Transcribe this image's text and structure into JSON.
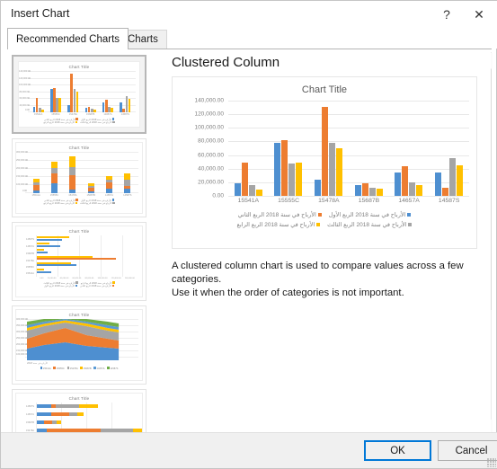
{
  "window": {
    "title": "Insert Chart",
    "help_icon": "question-mark-icon",
    "close_icon": "close-icon",
    "help_label": "?",
    "close_label": "✕"
  },
  "tabs": [
    {
      "label": "Recommended Charts",
      "active": true
    },
    {
      "label": "All Charts",
      "active": false
    }
  ],
  "scrollbar": {
    "up_arrow": "˄",
    "down_arrow": "˅"
  },
  "preview": {
    "heading": "Clustered Column",
    "description_line1": "A clustered column chart is used to compare values across a few categories.",
    "description_line2": "Use it when the order of categories is not important."
  },
  "footer": {
    "ok_label": "OK",
    "cancel_label": "Cancel"
  },
  "colors": {
    "series1": "#4e8fd0",
    "series2": "#ed7d31",
    "series3": "#a5a5a5",
    "series4": "#ffc000",
    "series5": "#5b9bd5",
    "series6": "#70ad47",
    "accent": "#0078d7",
    "gridline": "#e8e8e8",
    "axis_text": "#7f7f7f"
  },
  "chart_data": {
    "type": "bar",
    "title": "Chart Title",
    "xlabel": "",
    "ylabel": "",
    "ylim": [
      0,
      140000
    ],
    "ytick_labels": [
      "140,000.00",
      "120,000.00",
      "100,000.00",
      "80,000.00",
      "60,000.00",
      "40,000.00",
      "20,000.00",
      "0.00"
    ],
    "yticks": [
      140000,
      120000,
      100000,
      80000,
      60000,
      40000,
      20000,
      0
    ],
    "grid": true,
    "legend_position": "bottom",
    "categories": [
      "15541A",
      "15555C",
      "15478A",
      "15687B",
      "14657A",
      "14587S"
    ],
    "series": [
      {
        "name": "الأرباح في سنة 2018 الربع الأول",
        "color": "#4e8fd0",
        "values": [
          18000,
          78500,
          24000,
          16500,
          35000,
          35000
        ]
      },
      {
        "name": "الأرباح في سنة 2018 الربع الثاني",
        "color": "#ed7d31",
        "values": [
          49000,
          81500,
          131000,
          19000,
          43000,
          12000
        ]
      },
      {
        "name": "الأرباح في سنة 2018 الربع الثالث",
        "color": "#a5a5a5",
        "values": [
          16000,
          48000,
          78500,
          12000,
          20000,
          56000
        ]
      },
      {
        "name": "الأرباح في سنة 2018 الربع الرابع",
        "color": "#ffc000",
        "values": [
          9500,
          49000,
          70000,
          11000,
          16000,
          45500
        ]
      }
    ],
    "legend_entries": [
      {
        "label": "الأرباح في سنة 2018 الربع الأول",
        "color": "#4e8fd0"
      },
      {
        "label": "الأرباح في سنة 2018 الربع الثاني",
        "color": "#ed7d31"
      },
      {
        "label": "الأرباح في سنة 2018 الربع الثالث",
        "color": "#a5a5a5"
      },
      {
        "label": "الأرباح في سنة 2018 الربع الرابع",
        "color": "#ffc000"
      }
    ]
  },
  "thumbnails": [
    {
      "name": "clustered-column",
      "title": "Chart Title",
      "selected": true,
      "chart_type": "clustered-column"
    },
    {
      "name": "stacked-column",
      "title": "Chart Title",
      "selected": false,
      "chart_type": "stacked-column"
    },
    {
      "name": "clustered-bar",
      "title": "Chart Title",
      "selected": false,
      "chart_type": "clustered-bar"
    },
    {
      "name": "stacked-area",
      "title": "Chart Title",
      "selected": false,
      "chart_type": "stacked-area"
    },
    {
      "name": "stacked-bar",
      "title": "Chart Title",
      "selected": false,
      "chart_type": "stacked-bar"
    }
  ]
}
